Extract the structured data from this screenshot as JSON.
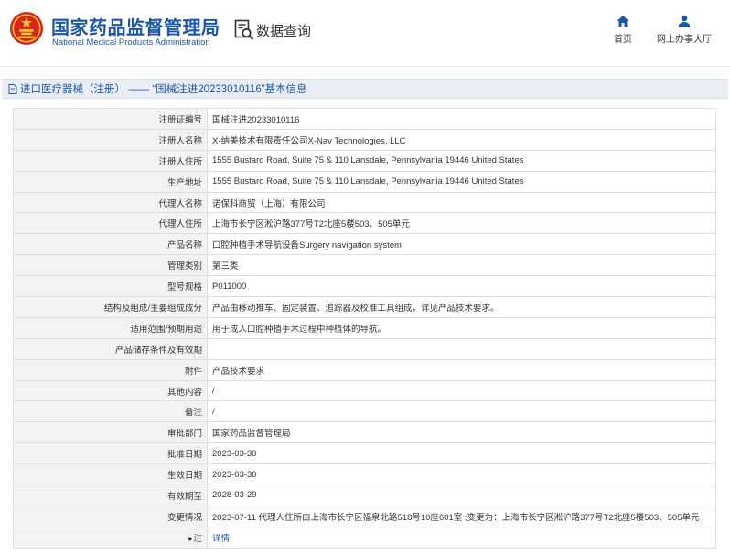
{
  "header": {
    "org_name_cn": "国家药品监督管理局",
    "org_name_en": "National Medical Products Administration",
    "query_label": "数据查询",
    "nav": {
      "home_label": "首页",
      "service_label": "网上办事大厅"
    }
  },
  "page_title": "进口医疗器械（注册） —— “国械注进20233010116”基本信息",
  "rows": [
    {
      "label": "注册证编号",
      "value": "国械注进20233010116"
    },
    {
      "label": "注册人名称",
      "value": "X-纳美技术有限责任公司X-Nav Technologies, LLC"
    },
    {
      "label": "注册人住所",
      "value": "1555 Bustard Road, Suite 75 & 110 Lansdale, Pennsylvania 19446 United States"
    },
    {
      "label": "生产地址",
      "value": "1555 Bustard Road, Suite 75 & 110 Lansdale, Pennsylvania 19446 United States"
    },
    {
      "label": "代理人名称",
      "value": "诺保科商贸（上海）有限公司"
    },
    {
      "label": "代理人住所",
      "value": "上海市长宁区淞沪路377号T2北座5楼503、505单元"
    },
    {
      "label": "产品名称",
      "value": "口腔种植手术导航设备Surgery navigation system"
    },
    {
      "label": "管理类别",
      "value": "第三类"
    },
    {
      "label": "型号规格",
      "value": "P011000"
    },
    {
      "label": "结构及组成/主要组成成分",
      "value": "产品由移动推车、固定装置、追踪器及校准工具组成，详见产品技术要求。"
    },
    {
      "label": "适用范围/预期用途",
      "value": "用于成人口腔种植手术过程中种植体的导航。"
    },
    {
      "label": "产品储存条件及有效期",
      "value": ""
    },
    {
      "label": "附件",
      "value": "产品技术要求"
    },
    {
      "label": "其他内容",
      "value": "/"
    },
    {
      "label": "备注",
      "value": "/"
    },
    {
      "label": "审批部门",
      "value": "国家药品监督管理局"
    },
    {
      "label": "批准日期",
      "value": "2023-03-30"
    },
    {
      "label": "生效日期",
      "value": "2023-03-30"
    },
    {
      "label": "有效期至",
      "value": "2028-03-29"
    },
    {
      "label": "变更情况",
      "value": "2023-07-11 代理人住所由上海市长宁区福泉北路518号10座601室 ;变更为：上海市长宁区淞沪路377号T2北座5楼503、505单元"
    }
  ],
  "note_row": {
    "label": "注",
    "link_text": "详情"
  },
  "colors": {
    "brand_blue": "#1b57a8",
    "emblem_red": "#d7261e",
    "title_bar_bg": "#eaeef4",
    "label_bg": "#f3f3f3"
  },
  "icons": [
    "national-emblem-icon",
    "data-query-icon",
    "home-icon",
    "user-icon",
    "document-icon",
    "pin-icon"
  ]
}
